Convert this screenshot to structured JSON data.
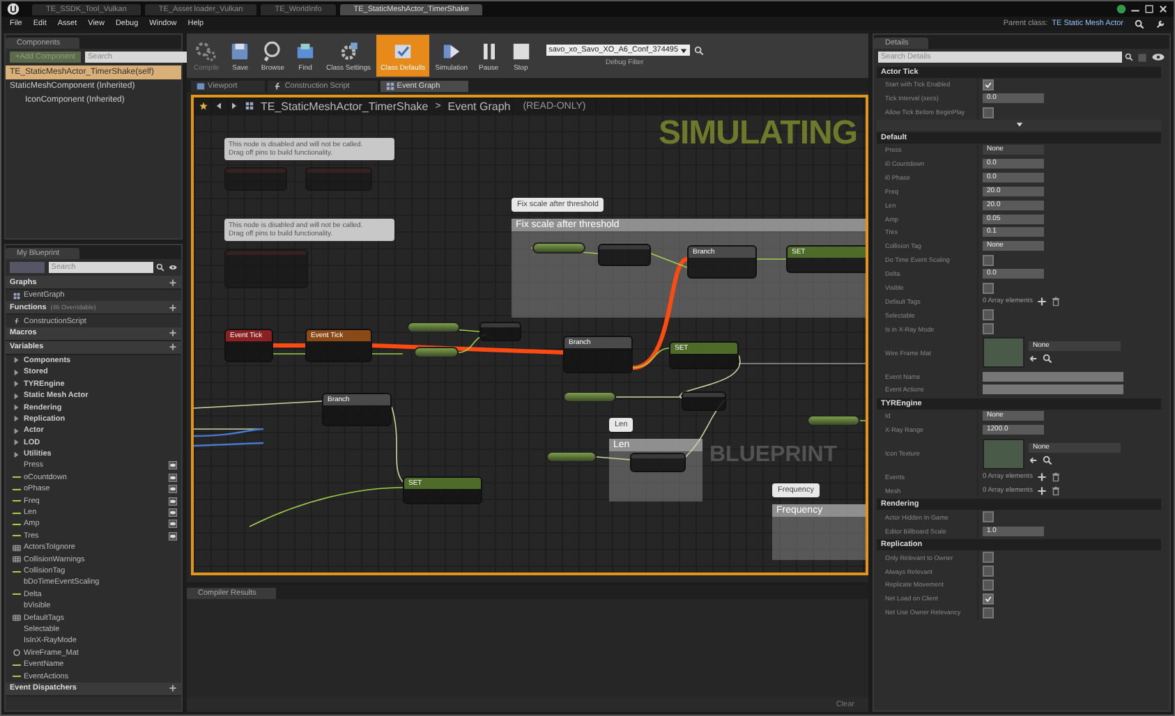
{
  "title_bar": {
    "tabs": [
      {
        "label": "TE_SSDK_Tool_Vulkan",
        "selected": false
      },
      {
        "label": "TE_Asset loader_Vulkan",
        "selected": false
      },
      {
        "label": "TE_WorldInfo",
        "selected": false
      },
      {
        "label": "TE_StaticMeshActor_TimerShake",
        "selected": true
      }
    ],
    "parent_class_label": "Parent class:",
    "parent_class": "TE Static Mesh Actor"
  },
  "menu": [
    "File",
    "Edit",
    "Asset",
    "View",
    "Debug",
    "Window",
    "Help"
  ],
  "components": {
    "tab": "Components",
    "add_button": "+Add Component",
    "search": {
      "placeholder": "Search"
    },
    "tree": [
      {
        "label": "TE_StaticMeshActor_TimerShake(self)",
        "selected": true
      },
      {
        "label": "StaticMeshComponent (Inherited)",
        "selected": false,
        "children": [
          {
            "label": "IconComponent (Inherited)",
            "selected": false
          }
        ]
      }
    ]
  },
  "toolbar": {
    "buttons": [
      {
        "label": "Compile",
        "kind": "compile",
        "active": false,
        "disabled": true
      },
      {
        "label": "Save",
        "kind": "save",
        "active": false,
        "disabled": false
      },
      {
        "label": "Browse",
        "kind": "browse",
        "active": false,
        "disabled": false
      },
      {
        "label": "Find",
        "kind": "find",
        "active": false,
        "disabled": false
      },
      {
        "label": "Class Settings",
        "kind": "settings",
        "active": false,
        "disabled": false
      },
      {
        "label": "Class Defaults",
        "kind": "defaults",
        "active": true,
        "disabled": false
      },
      {
        "label": "Simulation",
        "kind": "simulation",
        "active": false,
        "disabled": false
      },
      {
        "label": "Pause",
        "kind": "pause",
        "active": false,
        "disabled": false
      },
      {
        "label": "Stop",
        "kind": "stop",
        "active": false,
        "disabled": false
      }
    ],
    "debug_filter": {
      "value": "savo_xo_Savo_XO_A6_Conf_374495",
      "label": "Debug Filter"
    }
  },
  "editor_tabs": [
    {
      "label": "Viewport",
      "kind": "viewport",
      "selected": false
    },
    {
      "label": "Construction Script",
      "kind": "function",
      "selected": false
    },
    {
      "label": "Event Graph",
      "kind": "graph",
      "selected": true
    }
  ],
  "graph": {
    "breadcrumb": {
      "blueprint": "TE_StaticMeshActor_TimerShake",
      "separator": ">",
      "graph": "Event Graph",
      "mode": "(READ-ONLY)"
    },
    "overlay": "SIMULATING",
    "watermark": "BLUEPRINT",
    "notes": [
      {
        "text": "This node is disabled and will not be called.\nDrag off pins to build functionality."
      },
      {
        "text": "This node is disabled and will not be called.\nDrag off pins to build functionality."
      }
    ],
    "comment_boxes": [
      {
        "title": "Fix scale after threshold",
        "bubble": "Fix scale after threshold"
      },
      {
        "title": "Len",
        "bubble": "Len"
      },
      {
        "title": "Frequency",
        "bubble": "Frequency"
      }
    ],
    "nodes": [
      {
        "kind": "disabled"
      },
      {
        "kind": "disabled"
      },
      {
        "kind": "disabled"
      },
      {
        "kind": "event",
        "title": "Event Tick"
      },
      {
        "kind": "parent",
        "title": "Event Tick"
      },
      {
        "kind": "branch",
        "title": "Branch"
      },
      {
        "kind": "set",
        "title": "SET"
      },
      {
        "kind": "branch",
        "title": "Branch"
      },
      {
        "kind": "set",
        "title": "SET"
      },
      {
        "kind": "branch",
        "title": "Branch"
      },
      {
        "kind": "set",
        "title": "SET"
      },
      {
        "kind": "math"
      },
      {
        "kind": "math"
      },
      {
        "kind": "math"
      },
      {
        "kind": "math"
      }
    ]
  },
  "compiler": {
    "tab": "Compiler Results",
    "clear": "Clear"
  },
  "my_blueprint": {
    "tab": "My Blueprint",
    "search": {
      "placeholder": "Search"
    },
    "sections": [
      {
        "title": "Graphs",
        "items": [
          {
            "label": "EventGraph",
            "kind": "graph"
          }
        ]
      },
      {
        "title": "Functions",
        "note": "(46 Overridable)",
        "items": [
          {
            "label": "ConstructionScript",
            "kind": "function"
          }
        ]
      },
      {
        "title": "Macros"
      },
      {
        "title": "Variables",
        "items": [
          {
            "label": "Components",
            "kind": "category"
          },
          {
            "label": "Stored",
            "kind": "category"
          },
          {
            "label": "TYREngine",
            "kind": "category"
          },
          {
            "label": "Static Mesh Actor",
            "kind": "category"
          },
          {
            "label": "Rendering",
            "kind": "category"
          },
          {
            "label": "Replication",
            "kind": "category"
          },
          {
            "label": "Actor",
            "kind": "category"
          },
          {
            "label": "LOD",
            "kind": "category"
          },
          {
            "label": "Utilities",
            "kind": "category"
          },
          {
            "label": "Press",
            "kind": "name",
            "exposed": true
          },
          {
            "label": "oCountdown",
            "kind": "float",
            "exposed": true
          },
          {
            "label": "oPhase",
            "kind": "float",
            "exposed": true
          },
          {
            "label": "Freq",
            "kind": "float",
            "exposed": true
          },
          {
            "label": "Len",
            "kind": "float",
            "exposed": true
          },
          {
            "label": "Amp",
            "kind": "float",
            "exposed": true
          },
          {
            "label": "Tres",
            "kind": "float",
            "exposed": true
          },
          {
            "label": "ActorsToIgnore",
            "kind": "array",
            "exposed": false
          },
          {
            "label": "CollisionWarnings",
            "kind": "array",
            "exposed": false
          },
          {
            "label": "CollisionTag",
            "kind": "float",
            "exposed": false
          },
          {
            "label": "bDoTimeEventScaling",
            "kind": "bool",
            "exposed": false
          },
          {
            "label": "Delta",
            "kind": "float",
            "exposed": false
          },
          {
            "label": "bVisible",
            "kind": "bool",
            "exposed": false
          },
          {
            "label": "DefaultTags",
            "kind": "array",
            "exposed": false
          },
          {
            "label": "Selectable",
            "kind": "bool",
            "exposed": false
          },
          {
            "label": "IsInX-RayMode",
            "kind": "bool",
            "exposed": false
          },
          {
            "label": "WireFrame_Mat",
            "kind": "object",
            "exposed": false
          },
          {
            "label": "EventName",
            "kind": "float",
            "exposed": false
          },
          {
            "label": "EventActions",
            "kind": "float",
            "exposed": false
          }
        ]
      },
      {
        "title": "Event Dispatchers"
      }
    ]
  },
  "details": {
    "tab": "Details",
    "search": {
      "placeholder": "Search Details"
    },
    "sections": [
      {
        "title": "Actor Tick",
        "advanced": true,
        "rows": [
          {
            "label": "Start with Tick Enabled",
            "kind": "check",
            "checked": true
          },
          {
            "label": "Tick Interval (secs)",
            "kind": "number",
            "value": "0.0"
          },
          {
            "label": "Allow Tick Before BeginPlay",
            "kind": "check",
            "checked": false
          }
        ]
      },
      {
        "title": "Default",
        "advanced": false,
        "rows": [
          {
            "label": "Press",
            "kind": "select",
            "value": "None"
          },
          {
            "label": "i0 Countdown",
            "kind": "number",
            "value": "0.0"
          },
          {
            "label": "i0 Phase",
            "kind": "number",
            "value": "0.0"
          },
          {
            "label": "Freq",
            "kind": "number",
            "value": "20.0"
          },
          {
            "label": "Len",
            "kind": "number",
            "value": "20.0"
          },
          {
            "label": "Amp",
            "kind": "number",
            "value": "0.05"
          },
          {
            "label": "Tres",
            "kind": "number",
            "value": "0.1"
          },
          {
            "label": "Collision Tag",
            "kind": "text",
            "value": "None"
          },
          {
            "label": "Do Time Event Scaling",
            "kind": "check",
            "checked": false
          },
          {
            "label": "Delta",
            "kind": "number",
            "value": "0.0"
          },
          {
            "label": "Visible",
            "kind": "check",
            "checked": false
          },
          {
            "label": "Default Tags",
            "kind": "array",
            "value": "0 Array elements"
          },
          {
            "label": "Selectable",
            "kind": "check",
            "checked": false
          },
          {
            "label": "Is in X-Ray Mode",
            "kind": "check",
            "checked": false
          },
          {
            "label": "Wire Frame Mat",
            "kind": "asset",
            "value": "None"
          },
          {
            "label": "Event Name",
            "kind": "text"
          },
          {
            "label": "Event Actions",
            "kind": "text"
          }
        ]
      },
      {
        "title": "TYREngine",
        "advanced": false,
        "rows": [
          {
            "label": "Id",
            "kind": "text",
            "value": "None"
          },
          {
            "label": "X-Ray Range",
            "kind": "number",
            "value": "1200.0"
          },
          {
            "label": "Icon Texture",
            "kind": "asset",
            "value": "None"
          },
          {
            "label": "Events",
            "kind": "array",
            "value": "0 Array elements"
          },
          {
            "label": "Mesh",
            "kind": "array",
            "value": "0 Array elements"
          }
        ]
      },
      {
        "title": "Rendering",
        "advanced": false,
        "rows": [
          {
            "label": "Actor Hidden In Game",
            "kind": "check",
            "checked": false
          },
          {
            "label": "Editor Billboard Scale",
            "kind": "number",
            "value": "1.0"
          }
        ]
      },
      {
        "title": "Replication",
        "advanced": false,
        "rows": [
          {
            "label": "Only Relevant to Owner",
            "kind": "check",
            "checked": false
          },
          {
            "label": "Always Relevant",
            "kind": "check",
            "checked": false
          },
          {
            "label": "Replicate Movement",
            "kind": "check",
            "checked": false
          },
          {
            "label": "Net Load on Client",
            "kind": "check",
            "checked": true
          },
          {
            "label": "Net Use Owner Relevancy",
            "kind": "check",
            "checked": false
          }
        ]
      }
    ]
  }
}
